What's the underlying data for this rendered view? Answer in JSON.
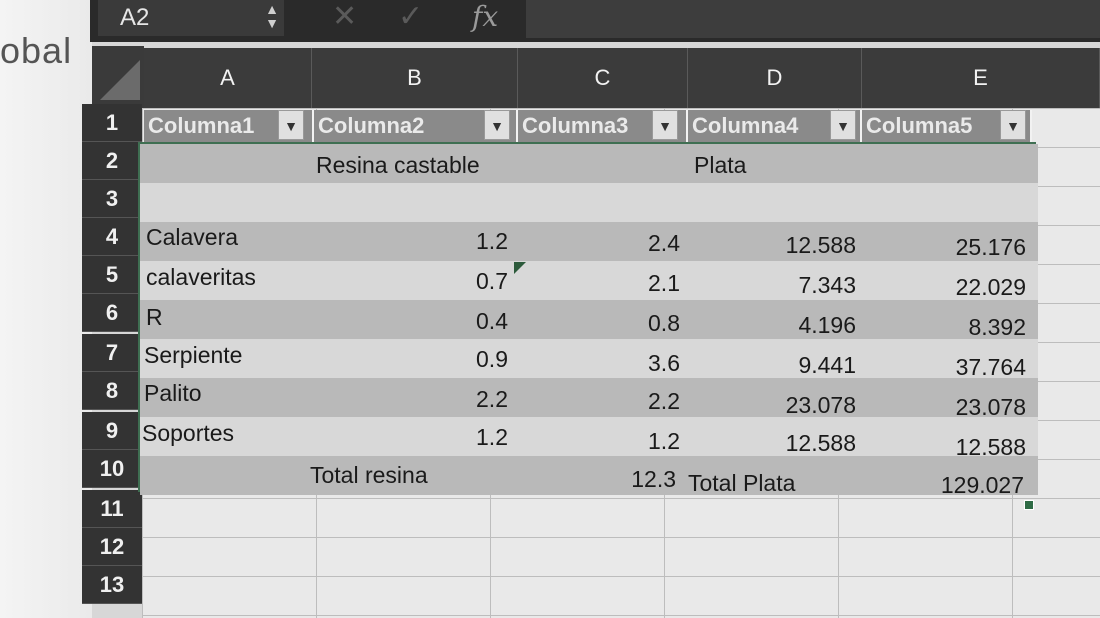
{
  "background_word": "obal",
  "formula_bar": {
    "name_box": "A2",
    "fx_label": "fx",
    "formula": ""
  },
  "columns": [
    "A",
    "B",
    "C",
    "D",
    "E"
  ],
  "rows": [
    "1",
    "2",
    "3",
    "4",
    "5",
    "6",
    "7",
    "8",
    "9",
    "10",
    "11",
    "12",
    "13"
  ],
  "table": {
    "headers": [
      "Columna1",
      "Columna2",
      "Columna3",
      "Columna4",
      "Columna5"
    ],
    "filter_glyph": "▼",
    "body": [
      [
        "",
        "Resina castable",
        "",
        "Plata",
        ""
      ],
      [
        "",
        "",
        "",
        "",
        ""
      ],
      [
        "Calavera",
        "1.2",
        "2.4",
        "12.588",
        "25.176"
      ],
      [
        "calaveritas",
        "0.7",
        "2.1",
        "7.343",
        "22.029"
      ],
      [
        "R",
        "0.4",
        "0.8",
        "4.196",
        "8.392"
      ],
      [
        "Serpiente",
        "0.9",
        "3.6",
        "9.441",
        "37.764"
      ],
      [
        "Palito",
        "2.2",
        "2.2",
        "23.078",
        "23.078"
      ],
      [
        "Soportes",
        "1.2",
        "1.2",
        "12.588",
        "12.588"
      ],
      [
        "",
        "Total resina",
        "12.3",
        "Total Plata",
        "129.027"
      ]
    ]
  },
  "colors": {
    "table_border": "#3f6f52",
    "band_dark": "#b9b9b9",
    "band_light": "#d8d8d8"
  }
}
